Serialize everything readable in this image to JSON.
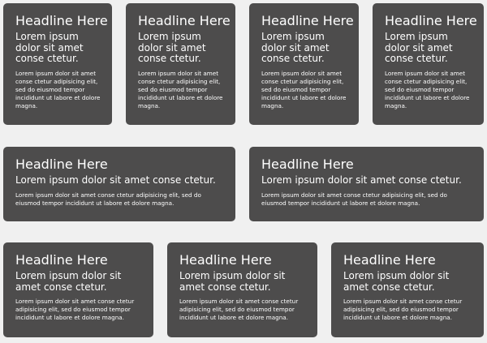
{
  "cards": [
    {
      "headline": "Headline Here",
      "subhead": "Lorem ipsum dolor sit amet conse ctetur.",
      "body": "Lorem ipsum dolor sit amet conse ctetur adipisicing elit, sed do eiusmod tempor incididunt ut labore et dolore magna."
    },
    {
      "headline": "Headline Here",
      "subhead": "Lorem ipsum dolor sit amet conse ctetur.",
      "body": "Lorem ipsum dolor sit amet conse ctetur adipisicing elit, sed do eiusmod tempor incididunt ut labore et dolore magna."
    },
    {
      "headline": "Headline Here",
      "subhead": "Lorem ipsum dolor sit amet conse ctetur.",
      "body": "Lorem ipsum dolor sit amet conse ctetur adipisicing elit, sed do eiusmod tempor incididunt ut labore et dolore magna."
    },
    {
      "headline": "Headline Here",
      "subhead": "Lorem ipsum dolor sit amet conse ctetur.",
      "body": "Lorem ipsum dolor sit amet conse ctetur adipisicing elit, sed do eiusmod tempor incididunt ut labore et dolore magna."
    },
    {
      "headline": "Headline Here",
      "subhead": "Lorem ipsum dolor sit amet conse ctetur.",
      "body": "Lorem ipsum dolor sit amet conse ctetur adipisicing elit, sed do eiusmod tempor incididunt ut labore et dolore magna."
    },
    {
      "headline": "Headline Here",
      "subhead": "Lorem ipsum dolor sit amet conse ctetur.",
      "body": "Lorem ipsum dolor sit amet conse ctetur adipisicing elit, sed do eiusmod tempor incididunt ut labore et dolore magna."
    },
    {
      "headline": "Headline Here",
      "subhead": "Lorem ipsum dolor sit amet conse ctetur.",
      "body": "Lorem ipsum dolor sit amet conse ctetur adipisicing elit, sed do eiusmod tempor incididunt ut labore et dolore magna."
    },
    {
      "headline": "Headline Here",
      "subhead": "Lorem ipsum dolor sit amet conse ctetur.",
      "body": "Lorem ipsum dolor sit amet conse ctetur adipisicing elit, sed do eiusmod tempor incididunt ut labore et dolore magna."
    },
    {
      "headline": "Headline Here",
      "subhead": "Lorem ipsum dolor sit amet conse ctetur.",
      "body": "Lorem ipsum dolor sit amet conse ctetur adipisicing elit, sed do eiusmod tempor incididunt ut labore et dolore magna."
    }
  ],
  "colors": {
    "background": "#f0f0f0",
    "card": "#4d4c4c",
    "text": "#ffffff"
  }
}
